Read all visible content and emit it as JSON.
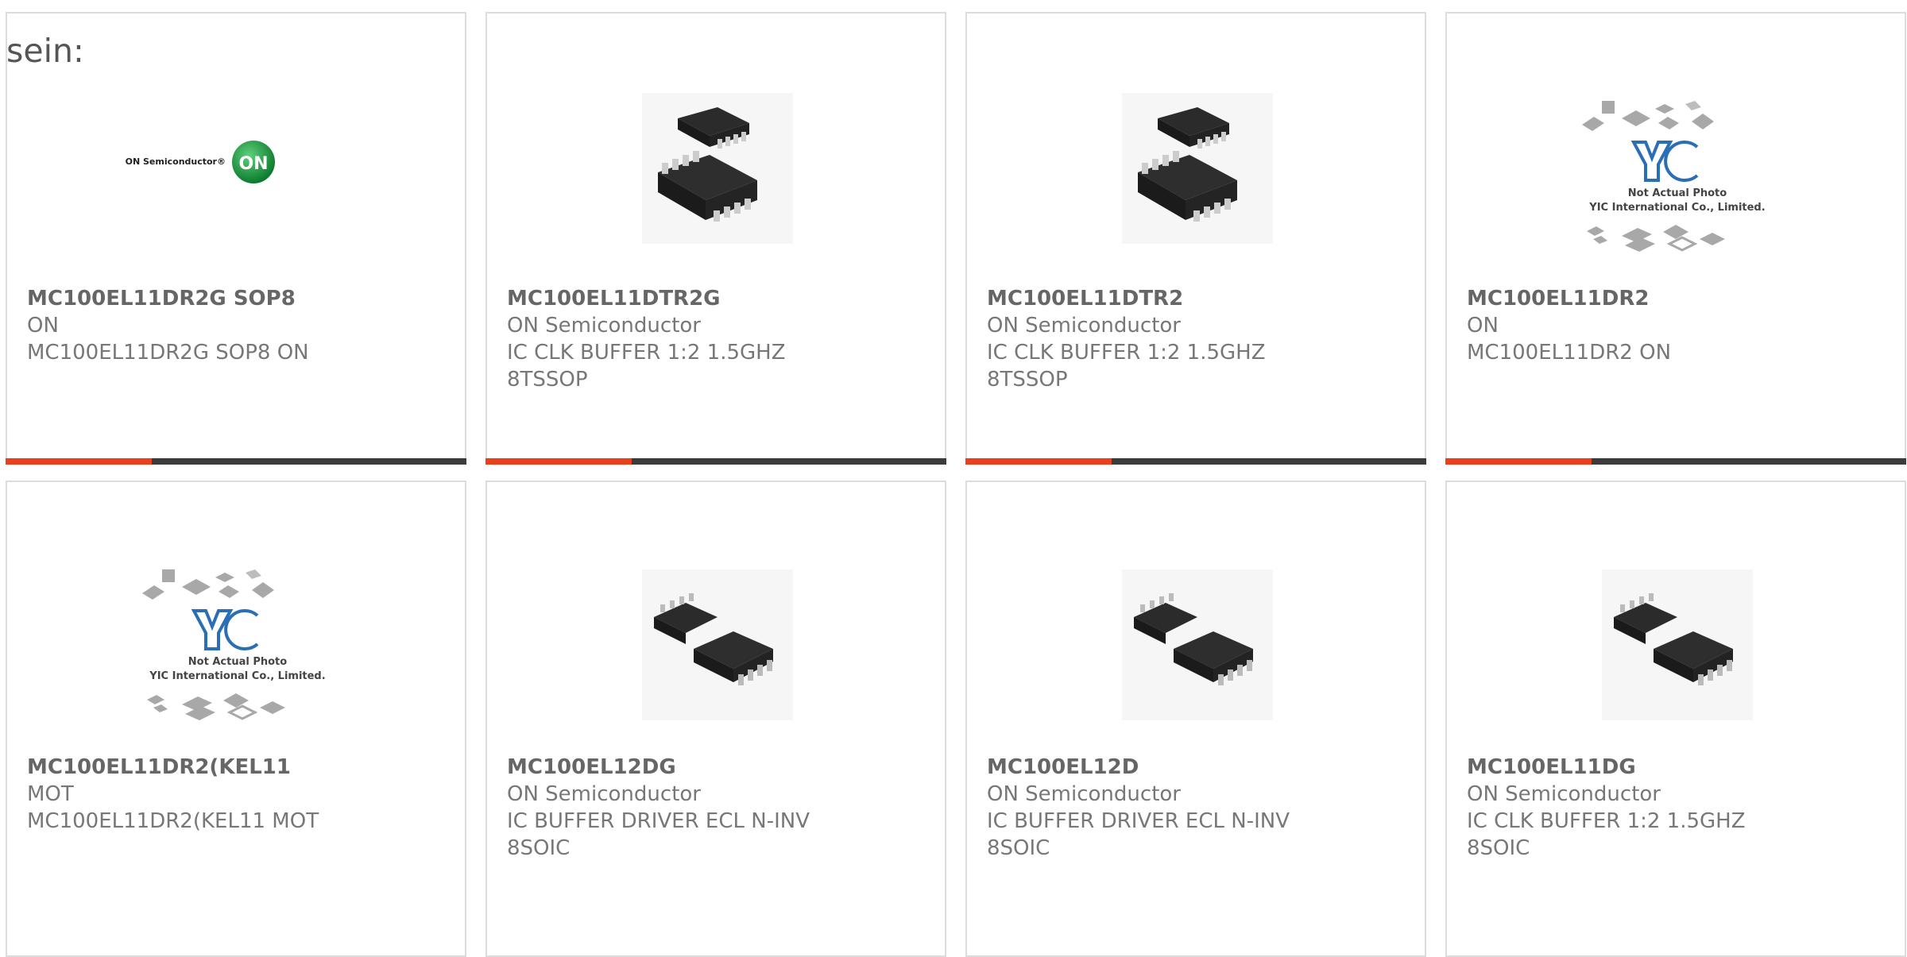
{
  "heading": "sein:",
  "colors": {
    "accent": "#e8401c",
    "bar": "#3b3b3b",
    "border": "#dcdcdc",
    "text": "#666666"
  },
  "products": [
    {
      "part": "MC100EL11DR2G SOP8",
      "maker": "ON",
      "desc_lines": [
        "MC100EL11DR2G SOP8 ON"
      ],
      "image": "on-semiconductor-logo"
    },
    {
      "part": "MC100EL11DTR2G",
      "maker": "ON Semiconductor",
      "desc_lines": [
        "IC CLK BUFFER 1:2 1.5GHZ",
        "8TSSOP"
      ],
      "image": "tssop8-chip-photo"
    },
    {
      "part": "MC100EL11DTR2",
      "maker": "ON Semiconductor",
      "desc_lines": [
        "IC CLK BUFFER 1:2 1.5GHZ",
        "8TSSOP"
      ],
      "image": "tssop8-chip-photo"
    },
    {
      "part": "MC100EL11DR2",
      "maker": "ON",
      "desc_lines": [
        "MC100EL11DR2 ON"
      ],
      "image": "yic-placeholder",
      "image_text": [
        "Not Actual Photo",
        "YIC International Co., Limited."
      ]
    },
    {
      "part": "MC100EL11DR2(KEL11",
      "maker": "MOT",
      "desc_lines": [
        "MC100EL11DR2(KEL11 MOT"
      ],
      "image": "yic-placeholder",
      "image_text": [
        "Not Actual Photo",
        "YIC International Co., Limited."
      ]
    },
    {
      "part": "MC100EL12DG",
      "maker": "ON Semiconductor",
      "desc_lines": [
        "IC BUFFER DRIVER ECL N-INV",
        "8SOIC"
      ],
      "image": "soic8-chip-photo"
    },
    {
      "part": "MC100EL12D",
      "maker": "ON Semiconductor",
      "desc_lines": [
        "IC BUFFER DRIVER ECL N-INV",
        "8SOIC"
      ],
      "image": "soic8-chip-photo"
    },
    {
      "part": "MC100EL11DG",
      "maker": "ON Semiconductor",
      "desc_lines": [
        "IC CLK BUFFER 1:2 1.5GHZ",
        "8SOIC"
      ],
      "image": "soic8-chip-photo"
    }
  ]
}
